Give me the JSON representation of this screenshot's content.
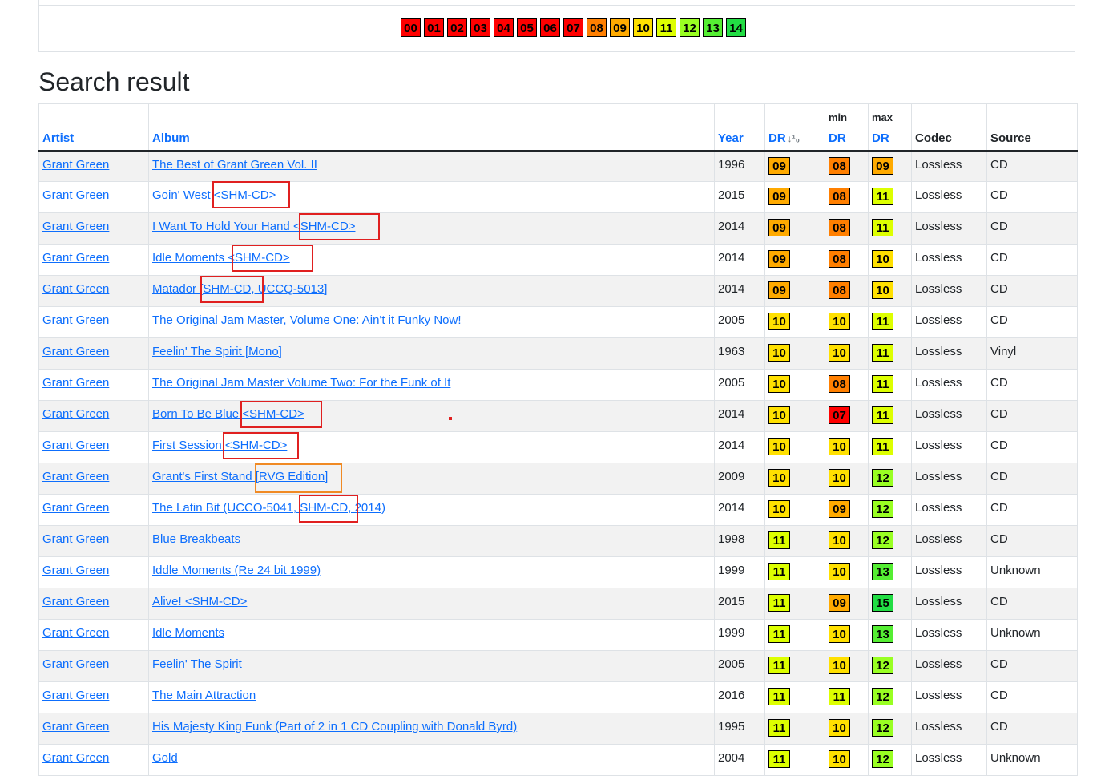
{
  "dr_colors": {
    "00": "#ff0000",
    "01": "#ff0000",
    "02": "#ff0000",
    "03": "#ff0000",
    "04": "#ff0000",
    "05": "#ff0000",
    "06": "#ff0000",
    "07": "#ff0000",
    "08": "#ff7f00",
    "09": "#ffaa00",
    "10": "#ffe000",
    "11": "#ddff00",
    "12": "#99ff22",
    "13": "#55ee33",
    "14": "#22dd44",
    "15": "#22dd44"
  },
  "legend": [
    "00",
    "01",
    "02",
    "03",
    "04",
    "05",
    "06",
    "07",
    "08",
    "09",
    "10",
    "11",
    "12",
    "13",
    "14"
  ],
  "page_title": "Search result",
  "table": {
    "headers": {
      "artist": "Artist",
      "album": "Album",
      "year": "Year",
      "dr": "DR",
      "min_label": "min",
      "min_dr": "DR",
      "max_label": "max",
      "max_dr": "DR",
      "codec": "Codec",
      "source": "Source"
    },
    "rows": [
      {
        "artist": "Grant Green",
        "album": "The Best of Grant Green Vol. II",
        "year": "1996",
        "dr": "09",
        "min": "08",
        "max": "09",
        "codec": "Lossless",
        "source": "CD"
      },
      {
        "artist": "Grant Green",
        "album": "Goin' West <SHM-CD>",
        "year": "2015",
        "dr": "09",
        "min": "08",
        "max": "11",
        "codec": "Lossless",
        "source": "CD"
      },
      {
        "artist": "Grant Green",
        "album": "I Want To Hold Your Hand <SHM-CD>",
        "year": "2014",
        "dr": "09",
        "min": "08",
        "max": "11",
        "codec": "Lossless",
        "source": "CD"
      },
      {
        "artist": "Grant Green",
        "album": "Idle Moments <SHM-CD>",
        "year": "2014",
        "dr": "09",
        "min": "08",
        "max": "10",
        "codec": "Lossless",
        "source": "CD"
      },
      {
        "artist": "Grant Green",
        "album": "Matador [SHM-CD, UCCQ-5013]",
        "year": "2014",
        "dr": "09",
        "min": "08",
        "max": "10",
        "codec": "Lossless",
        "source": "CD"
      },
      {
        "artist": "Grant Green",
        "album": "The Original Jam Master, Volume One: Ain't it Funky Now!",
        "year": "2005",
        "dr": "10",
        "min": "10",
        "max": "11",
        "codec": "Lossless",
        "source": "CD"
      },
      {
        "artist": "Grant Green",
        "album": "Feelin' The Spirit [Mono]",
        "year": "1963",
        "dr": "10",
        "min": "10",
        "max": "11",
        "codec": "Lossless",
        "source": "Vinyl"
      },
      {
        "artist": "Grant Green",
        "album": "The Original Jam Master Volume Two: For the Funk of It",
        "year": "2005",
        "dr": "10",
        "min": "08",
        "max": "11",
        "codec": "Lossless",
        "source": "CD"
      },
      {
        "artist": "Grant Green",
        "album": "Born To Be Blue <SHM-CD>",
        "year": "2014",
        "dr": "10",
        "min": "07",
        "max": "11",
        "codec": "Lossless",
        "source": "CD"
      },
      {
        "artist": "Grant Green",
        "album": "First Session <SHM-CD>",
        "year": "2014",
        "dr": "10",
        "min": "10",
        "max": "11",
        "codec": "Lossless",
        "source": "CD"
      },
      {
        "artist": "Grant Green",
        "album": "Grant's First Stand [RVG Edition]",
        "year": "2009",
        "dr": "10",
        "min": "10",
        "max": "12",
        "codec": "Lossless",
        "source": "CD"
      },
      {
        "artist": "Grant Green",
        "album": "The Latin Bit (UCCO-5041, SHM-CD, 2014)",
        "year": "2014",
        "dr": "10",
        "min": "09",
        "max": "12",
        "codec": "Lossless",
        "source": "CD"
      },
      {
        "artist": "Grant Green",
        "album": "Blue Breakbeats",
        "year": "1998",
        "dr": "11",
        "min": "10",
        "max": "12",
        "codec": "Lossless",
        "source": "CD"
      },
      {
        "artist": "Grant Green",
        "album": "Iddle Moments (Re 24 bit 1999)",
        "year": "1999",
        "dr": "11",
        "min": "10",
        "max": "13",
        "codec": "Lossless",
        "source": "Unknown"
      },
      {
        "artist": "Grant Green",
        "album": "Alive! <SHM-CD>",
        "year": "2015",
        "dr": "11",
        "min": "09",
        "max": "15",
        "codec": "Lossless",
        "source": "CD"
      },
      {
        "artist": "Grant Green",
        "album": "Idle Moments",
        "year": "1999",
        "dr": "11",
        "min": "10",
        "max": "13",
        "codec": "Lossless",
        "source": "Unknown"
      },
      {
        "artist": "Grant Green",
        "album": "Feelin' The Spirit",
        "year": "2005",
        "dr": "11",
        "min": "10",
        "max": "12",
        "codec": "Lossless",
        "source": "CD"
      },
      {
        "artist": "Grant Green",
        "album": "The Main Attraction",
        "year": "2016",
        "dr": "11",
        "min": "11",
        "max": "12",
        "codec": "Lossless",
        "source": "CD"
      },
      {
        "artist": "Grant Green",
        "album": "His Majesty King Funk (Part of 2 in 1 CD Coupling with Donald Byrd)",
        "year": "1995",
        "dr": "11",
        "min": "10",
        "max": "12",
        "codec": "Lossless",
        "source": "CD"
      },
      {
        "artist": "Grant Green",
        "album": "Gold",
        "year": "2004",
        "dr": "11",
        "min": "10",
        "max": "12",
        "codec": "Lossless",
        "source": "Unknown"
      }
    ]
  },
  "annotations": {
    "red": "#e02020",
    "orange": "#f08a24"
  }
}
